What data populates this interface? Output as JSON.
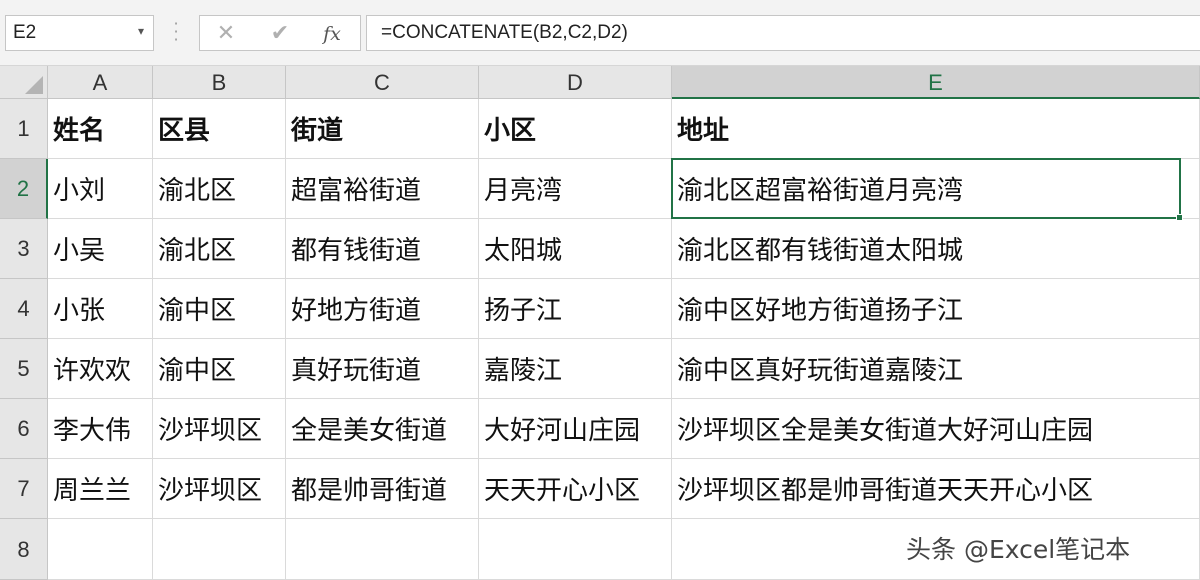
{
  "name_box": {
    "value": "E2",
    "dropdown_glyph": "▾"
  },
  "formula_bar": {
    "cancel_glyph": "✕",
    "enter_glyph": "✔",
    "fx_label": "fx",
    "formula": "=CONCATENATE(B2,C2,D2)"
  },
  "grid": {
    "columns": [
      "A",
      "B",
      "C",
      "D",
      "E"
    ],
    "active_column": "E",
    "rows": [
      "1",
      "2",
      "3",
      "4",
      "5",
      "6",
      "7",
      "8"
    ],
    "active_row": "2",
    "selected_cell": "E2",
    "cells": [
      [
        "姓名",
        "区县",
        "街道",
        "小区",
        "地址"
      ],
      [
        "小刘",
        "渝北区",
        "超富裕街道",
        "月亮湾",
        "渝北区超富裕街道月亮湾"
      ],
      [
        "小吴",
        "渝北区",
        "都有钱街道",
        "太阳城",
        "渝北区都有钱街道太阳城"
      ],
      [
        "小张",
        "渝中区",
        "好地方街道",
        "扬子江",
        "渝中区好地方街道扬子江"
      ],
      [
        "许欢欢",
        "渝中区",
        "真好玩街道",
        "嘉陵江",
        "渝中区真好玩街道嘉陵江"
      ],
      [
        "李大伟",
        "沙坪坝区",
        "全是美女街道",
        "大好河山庄园",
        "沙坪坝区全是美女街道大好河山庄园"
      ],
      [
        "周兰兰",
        "沙坪坝区",
        "都是帅哥街道",
        "天天开心小区",
        "沙坪坝区都是帅哥街道天天开心小区"
      ],
      [
        "",
        "",
        "",
        "",
        ""
      ]
    ]
  },
  "watermark": "头条 @Excel笔记本",
  "colors": {
    "accent": "#217346",
    "header_bg": "#e6e6e6",
    "gridline": "#dadada"
  }
}
